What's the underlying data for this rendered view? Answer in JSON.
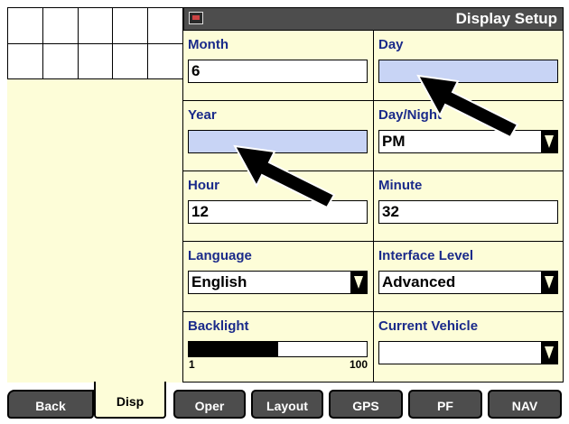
{
  "title_bar": {
    "title": "Display Setup",
    "icon": "display-icon"
  },
  "fields": {
    "month": {
      "label": "Month",
      "value": "6"
    },
    "day": {
      "label": "Day",
      "value": ""
    },
    "year": {
      "label": "Year",
      "value": ""
    },
    "day_night": {
      "label": "Day/Night",
      "value": "PM"
    },
    "hour": {
      "label": "Hour",
      "value": "12"
    },
    "minute": {
      "label": "Minute",
      "value": "32"
    },
    "language": {
      "label": "Language",
      "value": "English"
    },
    "interface_level": {
      "label": "Interface Level",
      "value": "Advanced"
    },
    "backlight": {
      "label": "Backlight",
      "min": "1",
      "max": "100",
      "level_percent": 50
    },
    "current_vehicle": {
      "label": "Current Vehicle",
      "value": ""
    }
  },
  "tabs": [
    {
      "label": "Back"
    },
    {
      "label": "Disp"
    },
    {
      "label": "Oper"
    },
    {
      "label": "Layout"
    },
    {
      "label": "GPS"
    },
    {
      "label": "PF"
    },
    {
      "label": "NAV"
    }
  ],
  "colors": {
    "panel_bg": "#fdfdd8",
    "label_color": "#1a2a8a",
    "highlight_field": "#c8d4f5",
    "tab_bg": "#4d4d4d"
  }
}
